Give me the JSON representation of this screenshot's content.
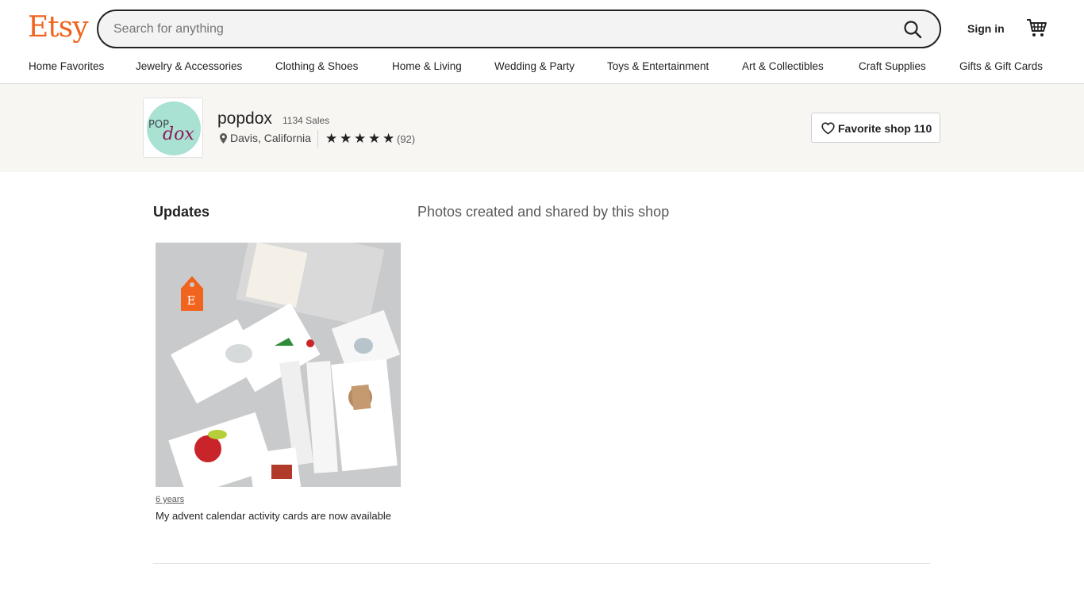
{
  "header": {
    "logo": "Etsy",
    "search_placeholder": "Search for anything",
    "sign_in": "Sign in",
    "icons": {
      "search": "search-icon",
      "cart": "cart-icon"
    }
  },
  "categories": [
    "Home Favorites",
    "Jewelry & Accessories",
    "Clothing & Shoes",
    "Home & Living",
    "Wedding & Party",
    "Toys & Entertainment",
    "Art & Collectibles",
    "Craft Supplies",
    "Gifts & Gift Cards"
  ],
  "shop": {
    "logo_text_a": "POP",
    "logo_text_b": "dox",
    "name": "popdox",
    "sales": "1134 Sales",
    "location": "Davis, California",
    "rating_stars": 5,
    "reviews": "(92)",
    "favorite_button": "Favorite shop 110"
  },
  "updates": {
    "title": "Updates",
    "subtitle": "Photos created and shared by this shop",
    "post": {
      "badge_letter": "E",
      "timestamp": "6 years",
      "caption": "My advent calendar activity cards are now available"
    }
  },
  "colors": {
    "brand": "#f1641e",
    "banner_bg": "#f8f6f3",
    "logo_circle": "#a9e1d3",
    "logo_script": "#8b1d5c"
  }
}
